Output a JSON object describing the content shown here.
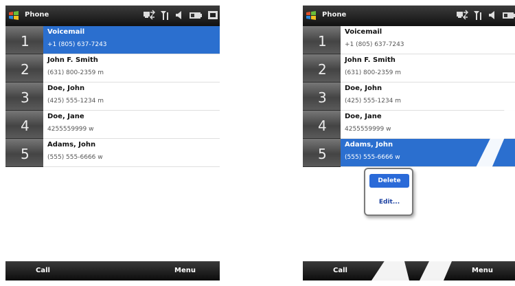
{
  "screens": [
    {
      "title": "Phone",
      "contacts": [
        {
          "speed_dial": "1",
          "name": "Voicemail",
          "number": "+1 (805) 637-7243"
        },
        {
          "speed_dial": "2",
          "name": "John F. Smith",
          "number": "(631) 800-2359 m"
        },
        {
          "speed_dial": "3",
          "name": "Doe, John",
          "number": "(425) 555-1234 m"
        },
        {
          "speed_dial": "4",
          "name": "Doe, Jane",
          "number": "4255559999 w"
        },
        {
          "speed_dial": "5",
          "name": "Adams, John",
          "number": "(555) 555-6666 w"
        }
      ],
      "selected_index": 0,
      "softkeys": {
        "left": "Call",
        "right": "Menu"
      }
    },
    {
      "title": "Phone",
      "contacts": [
        {
          "speed_dial": "1",
          "name": "Voicemail",
          "number": "+1 (805) 637-7243"
        },
        {
          "speed_dial": "2",
          "name": "John F. Smith",
          "number": "(631) 800-2359 m"
        },
        {
          "speed_dial": "3",
          "name": "Doe, John",
          "number": "(425) 555-1234 m"
        },
        {
          "speed_dial": "4",
          "name": "Doe, Jane",
          "number": "4255559999 w"
        },
        {
          "speed_dial": "5",
          "name": "Adams, John",
          "number": "(555) 555-6666 w"
        }
      ],
      "selected_index": 4,
      "context_menu": {
        "items": [
          "Delete",
          "Edit..."
        ],
        "active_index": 0
      },
      "softkeys": {
        "left": "Call",
        "right": "Menu"
      }
    }
  ],
  "colors": {
    "selection": "#2b6fcf",
    "title_bar": "#1a1a1a",
    "speed_tab": "#555555",
    "menu_active": "#2a6ad8",
    "watermark": "#ffffff"
  },
  "icons": [
    "windows-logo-icon",
    "connectivity-icon",
    "signal-icon",
    "volume-icon",
    "battery-icon"
  ]
}
